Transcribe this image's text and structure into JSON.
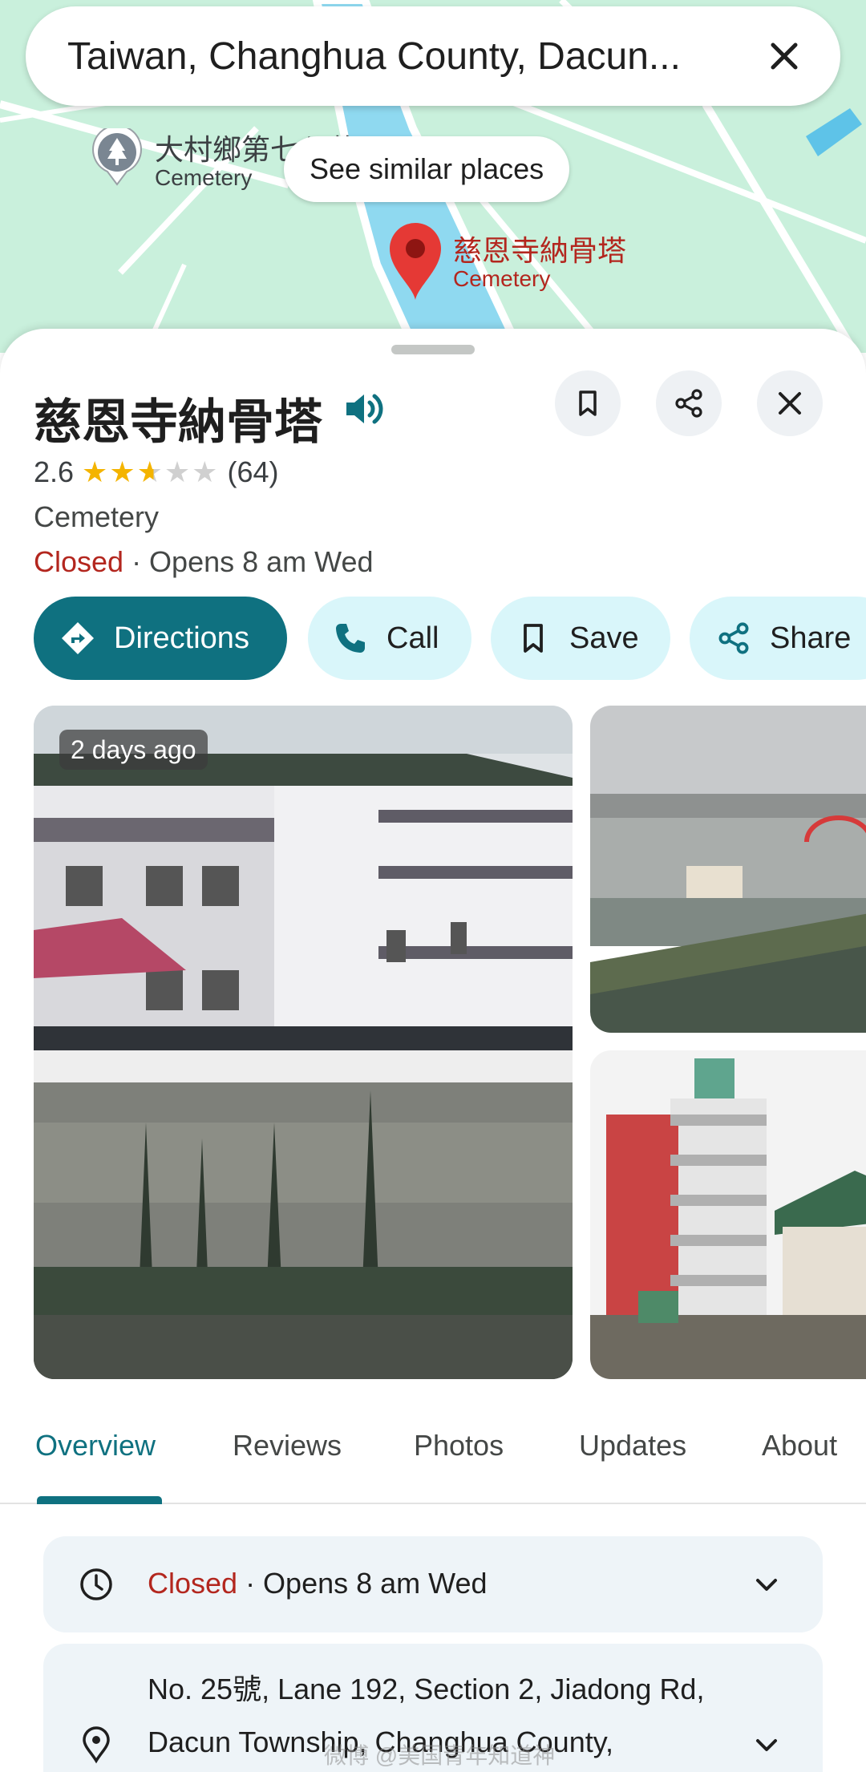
{
  "search": {
    "query": "Taiwan, Changhua County, Dacun..."
  },
  "map": {
    "poi_nearby": {
      "name": "大村鄉第七公墓",
      "category": "Cemetery"
    },
    "similar_places_label": "See similar places",
    "selected_pin": {
      "name": "慈恩寺納骨塔",
      "category": "Cemetery"
    }
  },
  "place": {
    "title": "慈恩寺納骨塔",
    "rating": "2.6",
    "rating_value": 2.6,
    "review_count": "(64)",
    "category": "Cemetery",
    "status": "Closed",
    "opens": " · Opens 8 am Wed"
  },
  "actions": {
    "directions": "Directions",
    "call": "Call",
    "save": "Save",
    "share": "Share"
  },
  "photos": {
    "main_badge": "2 days ago"
  },
  "tabs": [
    "Overview",
    "Reviews",
    "Photos",
    "Updates",
    "About"
  ],
  "info": {
    "hours_status": "Closed",
    "hours_opens": " · Opens 8 am Wed",
    "address": "No. 25號, Lane 192, Section 2, Jiadong Rd, Dacun Township, Changhua County,"
  },
  "watermark": "微博 @美国青年知道神",
  "colors": {
    "accent": "#0f7180",
    "button_tint": "#d9f6fa",
    "closed_red": "#b3261e",
    "star_yellow": "#f4b400",
    "map_green": "#c9f0dc",
    "map_water": "#8fd9f0"
  },
  "icons": {
    "search_close": "close-icon",
    "speaker": "volume-icon",
    "bookmark": "bookmark-icon",
    "share": "share-icon",
    "close": "close-icon",
    "directions": "directions-icon",
    "call": "phone-icon",
    "save": "bookmark-icon",
    "share_action": "share-icon",
    "hours": "clock-icon",
    "address": "location-pin-icon",
    "expand": "chevron-down-icon"
  }
}
